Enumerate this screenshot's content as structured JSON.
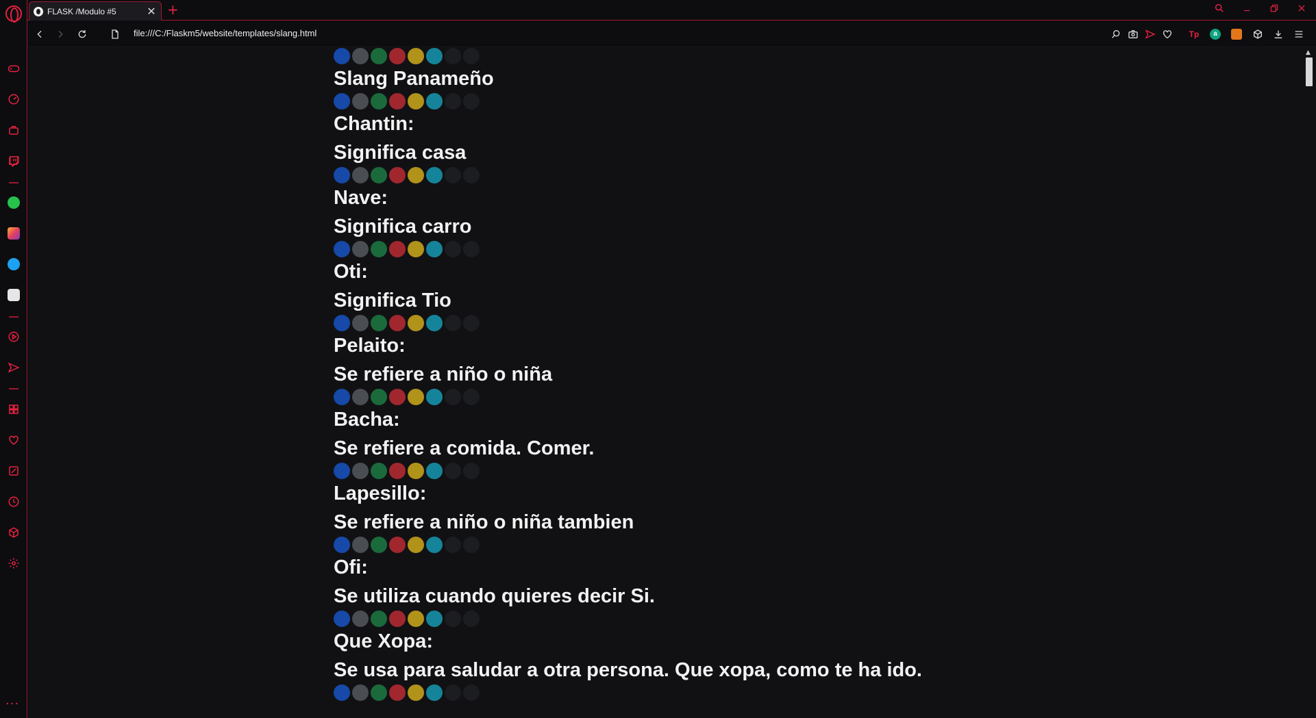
{
  "browser": {
    "tab_title": "FLASK /Modulo #5",
    "tab_close": "✕",
    "new_tab": "+",
    "url": "file:///C:/Flaskm5/website/templates/slang.html"
  },
  "sidebar": {
    "items": [
      "gamepad-icon",
      "speed-dial-icon",
      "extensions-icon",
      "twitch-icon",
      "whatsapp-icon",
      "instagram-icon",
      "twitter-icon",
      "discord-icon",
      "player-icon",
      "flow-icon",
      "workspaces-icon",
      "bookmarks-icon",
      "pinboard-icon",
      "history-icon",
      "crypto-icon",
      "settings-icon"
    ],
    "more": "···"
  },
  "colors": {
    "accent": "#e8213f",
    "dots": [
      "#1649a8",
      "#4a4d51",
      "#1b6a3c",
      "#a1272f",
      "#b1931a",
      "#15849a",
      "#1c1d20",
      "#1c1d20"
    ]
  },
  "page": {
    "title": "Slang Panameño",
    "entries": [
      {
        "term": "Chantin:",
        "meaning": "Significa casa"
      },
      {
        "term": "Nave:",
        "meaning": "Significa carro"
      },
      {
        "term": "Oti:",
        "meaning": "Significa Tio"
      },
      {
        "term": "Pelaito:",
        "meaning": "Se refiere a niño o niña"
      },
      {
        "term": "Bacha:",
        "meaning": "Se refiere a comida. Comer."
      },
      {
        "term": "Lapesillo:",
        "meaning": "Se refiere a niño o niña tambien"
      },
      {
        "term": "Ofi:",
        "meaning": "Se utiliza cuando quieres decir Si."
      },
      {
        "term": "Que Xopa:",
        "meaning": "Se usa para saludar a otra persona. Que xopa, como te ha ido."
      }
    ]
  }
}
